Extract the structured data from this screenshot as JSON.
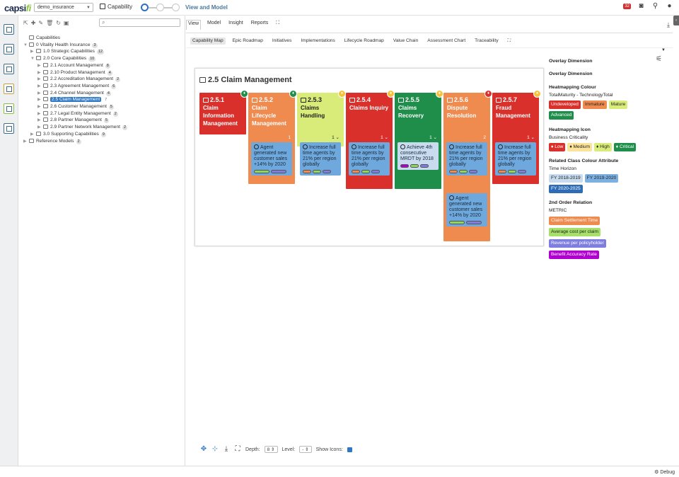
{
  "app": {
    "logo_main": "capsi",
    "logo_accent": "fi",
    "repository": "demo_insurance",
    "module": "Capability",
    "view_title": "View and Model",
    "notifications": "32"
  },
  "tree": {
    "items": [
      {
        "label": "Capabilities",
        "count": "",
        "depth": 0,
        "arrow": "",
        "selected": false
      },
      {
        "label": "0 Vitality Health Insurance",
        "count": "3",
        "depth": 0,
        "arrow": "▼",
        "selected": false
      },
      {
        "label": "1.0 Strategic Capabilities",
        "count": "12",
        "depth": 1,
        "arrow": "▶",
        "selected": false
      },
      {
        "label": "2.0 Core Capabilities",
        "count": "10",
        "depth": 1,
        "arrow": "▼",
        "selected": false
      },
      {
        "label": "2.1 Account Management",
        "count": "8",
        "depth": 2,
        "arrow": "▶",
        "selected": false
      },
      {
        "label": "2.10 Product Management",
        "count": "4",
        "depth": 2,
        "arrow": "▶",
        "selected": false
      },
      {
        "label": "2.2 Accreditation Management",
        "count": "2",
        "depth": 2,
        "arrow": "▶",
        "selected": false
      },
      {
        "label": "2.3 Agreement Management",
        "count": "6",
        "depth": 2,
        "arrow": "▶",
        "selected": false
      },
      {
        "label": "2.4 Channel Management",
        "count": "4",
        "depth": 2,
        "arrow": "▶",
        "selected": false
      },
      {
        "label": "2.5 Claim Management",
        "count": "7",
        "depth": 2,
        "arrow": "▶",
        "selected": true
      },
      {
        "label": "2.6 Customer Management",
        "count": "5",
        "depth": 2,
        "arrow": "▶",
        "selected": false
      },
      {
        "label": "2.7 Legal Entity Management",
        "count": "2",
        "depth": 2,
        "arrow": "▶",
        "selected": false
      },
      {
        "label": "2.8 Partner Management",
        "count": "5",
        "depth": 2,
        "arrow": "▶",
        "selected": false
      },
      {
        "label": "2.9 Partner Network Management",
        "count": "2",
        "depth": 2,
        "arrow": "▶",
        "selected": false
      },
      {
        "label": "3.0 Supporting Capabilities",
        "count": "9",
        "depth": 1,
        "arrow": "▶",
        "selected": false
      },
      {
        "label": "Reference Models",
        "count": "2",
        "depth": 0,
        "arrow": "▶",
        "selected": false
      }
    ]
  },
  "main_tabs": [
    "View",
    "Model",
    "Insight",
    "Reports",
    "⛶"
  ],
  "sub_tabs": [
    "Capability Map",
    "Epic Roadmap",
    "Initiatives",
    "Implementations",
    "Lifecycle Roadmap",
    "Value Chain",
    "Assessment Chart",
    "Traceability",
    "⛶"
  ],
  "capability_map": {
    "title": "2.5 Claim Management",
    "capabilities": [
      {
        "id": "2.5.1",
        "name": "Claim Information Management",
        "color": "#d9302c",
        "hm": "#1e8e4a",
        "count": "",
        "metrics": []
      },
      {
        "id": "2.5.2",
        "name": "Claim Lifecycle Management",
        "color": "#f08b50",
        "hm": "#1e8e4a",
        "count": "1",
        "metrics": [
          {
            "text": "Agent generated new customer sales +14% by 2020",
            "bars": [
              "#8fd65a",
              "#7e7ee0"
            ]
          }
        ]
      },
      {
        "id": "2.5.3",
        "name": "Claims Handling",
        "color": "#d9ec7a",
        "hm": "#f5c33b",
        "count": "1",
        "dark": true,
        "metrics": [
          {
            "text": "Increase full time agents by 21% per region globally",
            "bars": [
              "#f08b50",
              "#8fd65a",
              "#7e7ee0"
            ]
          }
        ]
      },
      {
        "id": "2.5.4",
        "name": "Claims Inquiry",
        "color": "#d9302c",
        "hm": "#f5c33b",
        "count": "1",
        "metrics": [
          {
            "text": "Increase full time agents by 21% per region globally",
            "bars": [
              "#f08b50",
              "#8fd65a",
              "#7e7ee0"
            ]
          }
        ]
      },
      {
        "id": "2.5.5",
        "name": "Claims Recovery",
        "color": "#1e8e4a",
        "hm": "#f5c33b",
        "count": "1",
        "metrics": [
          {
            "text": "Achieve 4th consecutive MRDT by 2018",
            "bars": [
              "#b000d0",
              "#8fd65a",
              "#7e7ee0"
            ],
            "light": true
          }
        ]
      },
      {
        "id": "2.5.6",
        "name": "Dispute Resolution",
        "color": "#f08b50",
        "hm": "#d9302c",
        "count": "2",
        "metrics": [
          {
            "text": "Increase full time agents by 21% per region globally",
            "bars": [
              "#f08b50",
              "#8fd65a",
              "#7e7ee0"
            ]
          },
          {
            "text": "Agent generated new customer sales +14% by 2020",
            "bars": [
              "#8fd65a",
              "#7e7ee0"
            ]
          }
        ]
      },
      {
        "id": "2.5.7",
        "name": "Fraud Management",
        "color": "#d9302c",
        "hm": "#f5c33b",
        "count": "1",
        "metrics": [
          {
            "text": "Increase full time agents by 21% per region globally",
            "bars": [
              "#f08b50",
              "#8fd65a",
              "#7e7ee0"
            ]
          }
        ]
      }
    ]
  },
  "bottom_tools": {
    "depth_label": "Depth:",
    "depth_value": "8",
    "level_label": "Level:",
    "level_value": "-",
    "show_icons_label": "Show Icons:"
  },
  "right_panel": {
    "overlay_dimension_1": "Overlay Dimension",
    "overlay_dimension_2": "Overlay Dimension",
    "heatmap_colour_head": "Heatmapping Colour",
    "heatmap_colour_sub": "TotalMaturity - TechnologyTotal",
    "colour_chips": [
      {
        "label": "Undeveloped",
        "bg": "#d9302c",
        "fg": "#fff"
      },
      {
        "label": "Immature",
        "bg": "#f08b50",
        "fg": "#222"
      },
      {
        "label": "Mature",
        "bg": "#d9ec7a",
        "fg": "#222"
      },
      {
        "label": "Advanced",
        "bg": "#1e8e4a",
        "fg": "#fff"
      }
    ],
    "heatmap_icon_head": "Heatmapping Icon",
    "heatmap_icon_sub": "Business Criticality",
    "icon_chips": [
      {
        "label": "Low",
        "bg": "#d9302c",
        "fg": "#fff"
      },
      {
        "label": "Medium",
        "bg": "#fbe39a",
        "fg": "#222"
      },
      {
        "label": "High",
        "bg": "#d9ec7a",
        "fg": "#222"
      },
      {
        "label": "Critical",
        "bg": "#1e8e4a",
        "fg": "#fff"
      }
    ],
    "related_head": "Related Class Colour Attribute",
    "related_sub": "Time Horizon",
    "time_chips": [
      {
        "label": "FY 2018-2019",
        "bg": "#c9dcef",
        "fg": "#222"
      },
      {
        "label": "FY 2019-2020",
        "bg": "#7bb0e0",
        "fg": "#222"
      },
      {
        "label": "FY 2020-2025",
        "bg": "#2e6db5",
        "fg": "#fff"
      }
    ],
    "second_head": "2nd Order Relation",
    "second_sub": "METRIC",
    "metric_chips": [
      {
        "label": "Claim Settlement Time",
        "bg": "#f08b50",
        "fg": "#fff"
      },
      {
        "label": "Average cost per claim",
        "bg": "#a6e06a",
        "fg": "#222"
      },
      {
        "label": "Revenue per policyholder",
        "bg": "#7e7ee0",
        "fg": "#fff"
      },
      {
        "label": "Benefit Accuracy Rate",
        "bg": "#b000d0",
        "fg": "#fff"
      }
    ]
  },
  "footer": {
    "debug": "Debug"
  }
}
